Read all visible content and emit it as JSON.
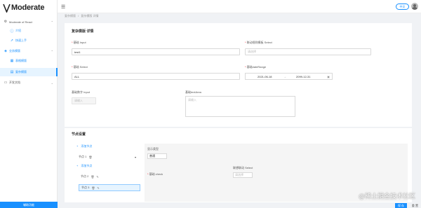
{
  "app": {
    "logo_text": "Moderate"
  },
  "sidebar": {
    "items": [
      {
        "label": "Moderate of React",
        "icon": "gear-icon",
        "chev": "⌃"
      },
      {
        "label": "介绍",
        "icon": "info-icon"
      },
      {
        "label": "快速上手",
        "icon": "rocket-icon"
      },
      {
        "label": "业务模版",
        "icon": "layers-icon",
        "chev": "⌃"
      },
      {
        "label": "表格模版",
        "icon": "table-icon"
      },
      {
        "label": "复杂模版",
        "icon": "form-icon"
      },
      {
        "label": "开发文档",
        "icon": "doc-icon",
        "chev": "⌄"
      }
    ],
    "footer": "辅助功能"
  },
  "header": {
    "lang_button": "中文"
  },
  "breadcrumb": [
    "复杂模版",
    "/",
    "复杂模版 详情"
  ],
  "form": {
    "title": "复杂模版 详情",
    "name": {
      "label": "基础 Input",
      "value": "test1"
    },
    "linkage": {
      "label": "联动规则模板 Select",
      "placeholder": "请选择"
    },
    "basic_select": {
      "label": "基础 Select",
      "value": "ALL"
    },
    "date_range": {
      "label": "基础dateRange",
      "start": "2021-06-18",
      "sep": "→",
      "end": "2099-12-31"
    },
    "number": {
      "label": "基础数字 Input",
      "placeholder": "请输入"
    },
    "textarea": {
      "label": "基础textArea",
      "placeholder": "请输入"
    }
  },
  "nodes": {
    "title": "节点设置",
    "add_label": "添加节点",
    "node1": "节点 1",
    "add_label_2": "添加节点",
    "node2": "节点 2",
    "node3": "节点 3",
    "detail": {
      "display_type_label": "显示类型",
      "display_type_value": "普通",
      "checkbox_label": "基础 check",
      "linkage_label": "联想联动 Select",
      "linkage_placeholder": "请选择"
    }
  },
  "actions": {
    "primary": "保 存",
    "secondary": "重 置"
  },
  "watermark": "@稀土掘金技术社区",
  "colors": {
    "primary": "#1890ff",
    "required": "#f5222d"
  }
}
